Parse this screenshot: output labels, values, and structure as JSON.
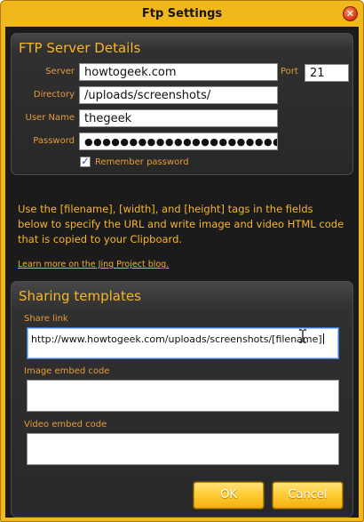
{
  "window": {
    "title": "Ftp Settings"
  },
  "ftp_server": {
    "heading": "FTP Server Details",
    "server_label": "Server",
    "server_value": "howtogeek.com",
    "port_label": "Port",
    "port_value": "21",
    "directory_label": "Directory",
    "directory_value": "/uploads/screenshots/",
    "username_label": "User Name",
    "username_value": "thegeek",
    "password_label": "Password",
    "password_value": "●●●●●●●●●●●●●●●●●●●●●●●●●●",
    "remember_label": "Remember password",
    "remember_checked": true
  },
  "info": {
    "text": "Use the [filename], [width], and [height] tags in the fields below to specify the URL and write image and video HTML code that is copied to your Clipboard.",
    "link_text": "Learn more on the Jing Project blog."
  },
  "sharing": {
    "heading": "Sharing templates",
    "share_link_label": "Share link",
    "share_link_value": "http://www.howtogeek.com/uploads/screenshots/[filename]",
    "image_embed_label": "Image embed code",
    "image_embed_value": "",
    "video_embed_label": "Video embed code",
    "video_embed_value": ""
  },
  "buttons": {
    "ok": "OK",
    "cancel": "Cancel"
  },
  "colors": {
    "accent": "#f7b52a",
    "label": "#e69b3c",
    "frame": "#f0b81c",
    "panel": "#1b1b1b"
  },
  "icons": {
    "close": "close-icon",
    "text_cursor": "text-cursor-icon",
    "check": "checkmark-icon"
  }
}
